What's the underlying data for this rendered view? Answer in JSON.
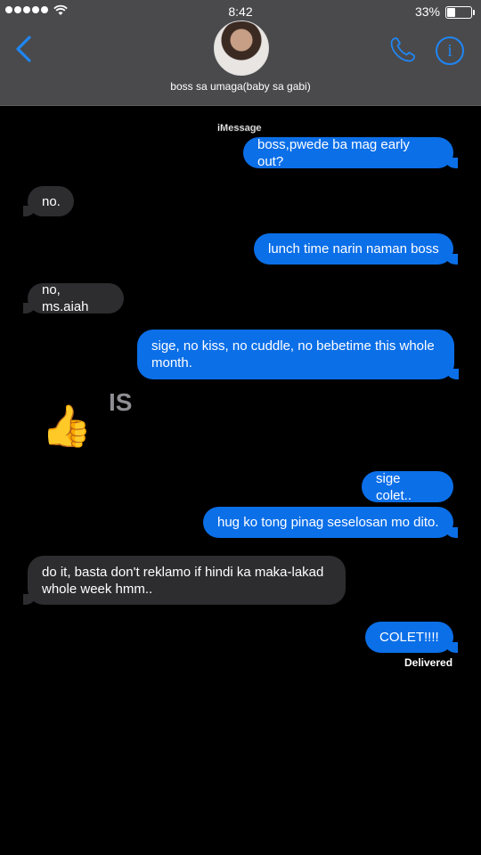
{
  "status_bar": {
    "time": "8:42",
    "battery": "33%",
    "battery_level": 0.33
  },
  "header": {
    "contact_name": "boss sa umaga(baby sa gabi)",
    "icons": [
      "back-chevron-icon",
      "phone-icon",
      "info-icon"
    ],
    "info_glyph": "i"
  },
  "conversation": {
    "service_label": "iMessage",
    "messages": [
      {
        "from": "me",
        "text": "boss,pwede ba mag early out?"
      },
      {
        "from": "them",
        "text": "no."
      },
      {
        "from": "me",
        "text": "lunch time narin naman boss"
      },
      {
        "from": "them",
        "text": "no, ms.aiah"
      },
      {
        "from": "me",
        "text": "sige, no kiss, no cuddle, no bebetime this whole month."
      },
      {
        "from": "them",
        "text": "👍",
        "overlay": "IS"
      },
      {
        "from": "me",
        "text": "sige colet.."
      },
      {
        "from": "me",
        "text": "hug ko tong pinag seselosan mo dito."
      },
      {
        "from": "them",
        "text": "do it, basta don't reklamo if hindi ka maka-lakad whole week hmm.."
      },
      {
        "from": "me",
        "text": "COLET!!!!"
      }
    ],
    "delivered_label": "Delivered"
  },
  "colors": {
    "outgoing": "#0b6fe8",
    "incoming": "#2d2d30",
    "header": "#4a4a4c",
    "accent": "#1f86f5"
  }
}
